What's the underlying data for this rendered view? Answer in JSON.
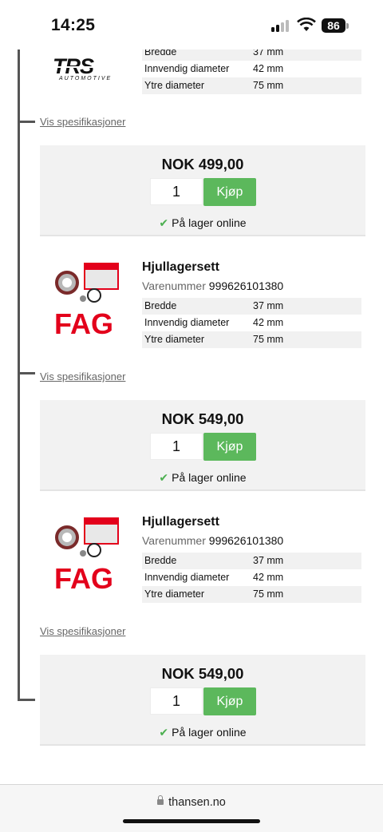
{
  "status_bar": {
    "time": "14:25",
    "battery": "86"
  },
  "products": [
    {
      "brand": "TRS",
      "brand_sub": "AUTOMOTIVE",
      "specs": [
        {
          "label": "Bredde",
          "value": "37 mm"
        },
        {
          "label": "Innvendig diameter",
          "value": "42 mm"
        },
        {
          "label": "Ytre diameter",
          "value": "75 mm"
        }
      ],
      "specs_link": "Vis spesifikasjoner",
      "price": "NOK 499,00",
      "quantity": "1",
      "buy_label": "Kjøp",
      "stock": "På lager online"
    },
    {
      "brand": "FAG",
      "title": "Hjullagersett",
      "partno_label": "Varenummer",
      "partno": "999626101380",
      "specs": [
        {
          "label": "Bredde",
          "value": "37 mm"
        },
        {
          "label": "Innvendig diameter",
          "value": "42 mm"
        },
        {
          "label": "Ytre diameter",
          "value": "75 mm"
        }
      ],
      "specs_link": "Vis spesifikasjoner",
      "price": "NOK 549,00",
      "quantity": "1",
      "buy_label": "Kjøp",
      "stock": "På lager online"
    },
    {
      "brand": "FAG",
      "title": "Hjullagersett",
      "partno_label": "Varenummer",
      "partno": "999626101380",
      "specs": [
        {
          "label": "Bredde",
          "value": "37 mm"
        },
        {
          "label": "Innvendig diameter",
          "value": "42 mm"
        },
        {
          "label": "Ytre diameter",
          "value": "75 mm"
        }
      ],
      "specs_link": "Vis spesifikasjoner",
      "price": "NOK 549,00",
      "quantity": "1",
      "buy_label": "Kjøp",
      "stock": "På lager online"
    }
  ],
  "browser": {
    "url": "thansen.no"
  },
  "colors": {
    "buy_button": "#5cb85c",
    "fag_red": "#e3001b",
    "check": "#4caf50"
  }
}
